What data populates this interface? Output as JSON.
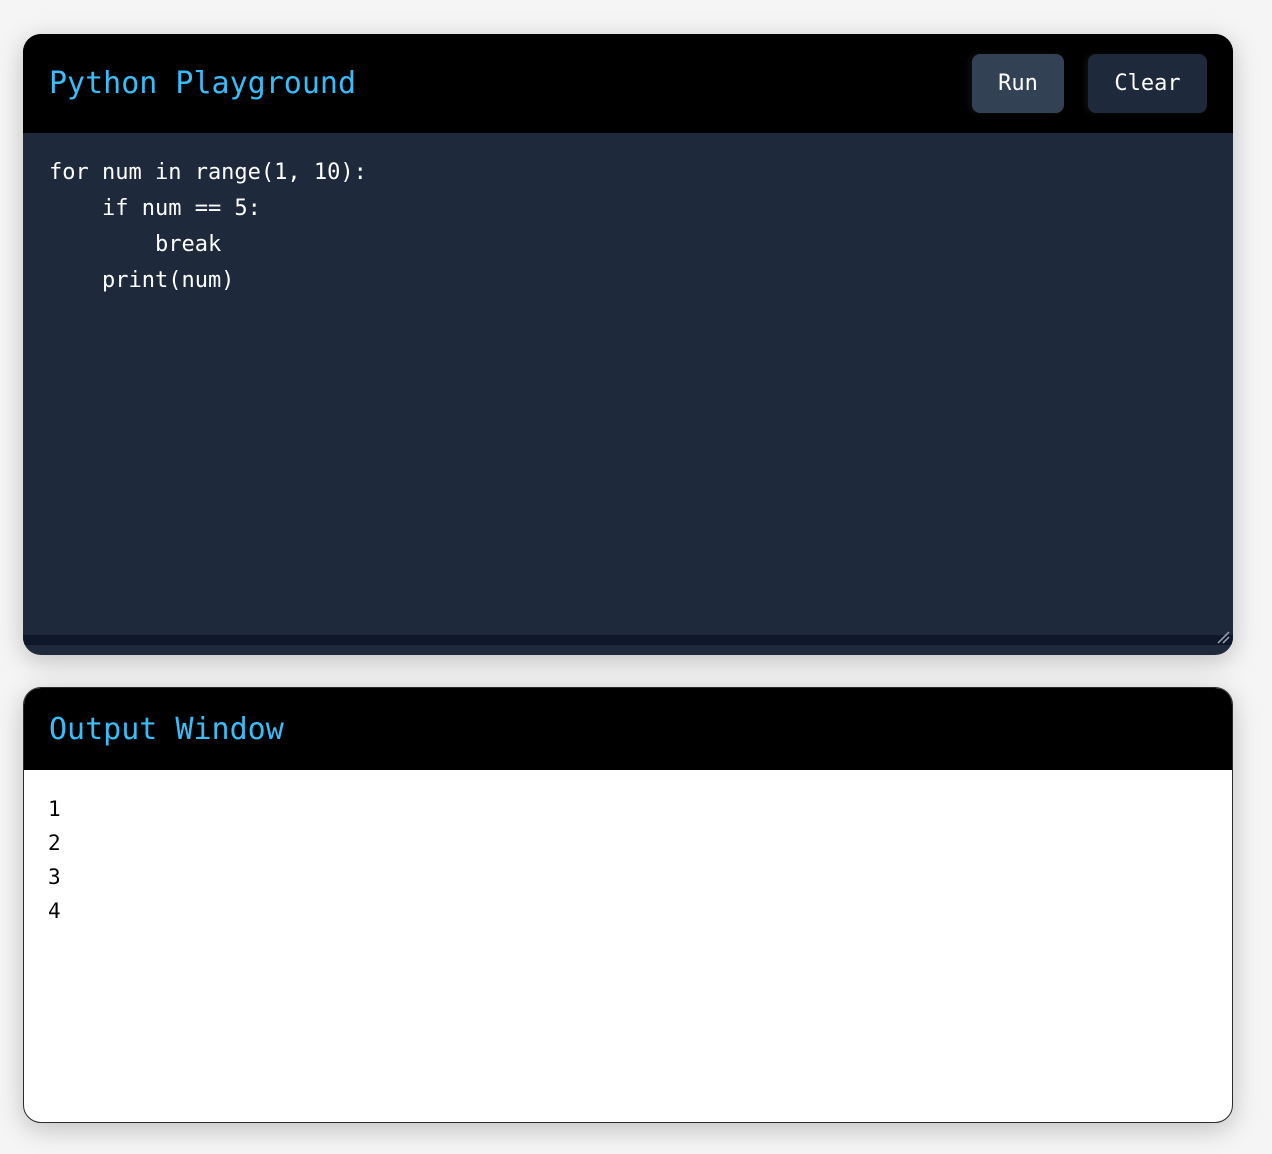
{
  "editor": {
    "title": "Python Playground",
    "run_label": "Run",
    "clear_label": "Clear",
    "code": "for num in range(1, 10):\n    if num == 5:\n        break\n    print(num)"
  },
  "output": {
    "title": "Output Window",
    "lines": [
      "1",
      "2",
      "3",
      "4"
    ]
  },
  "colors": {
    "accent": "#38bdf8",
    "header_bg": "#000000",
    "editor_bg": "#1e293b",
    "run_button_bg": "#334155",
    "clear_button_bg": "#1e293b",
    "output_bg": "#ffffff"
  },
  "icons": {
    "resize": "resize-handle-icon"
  }
}
